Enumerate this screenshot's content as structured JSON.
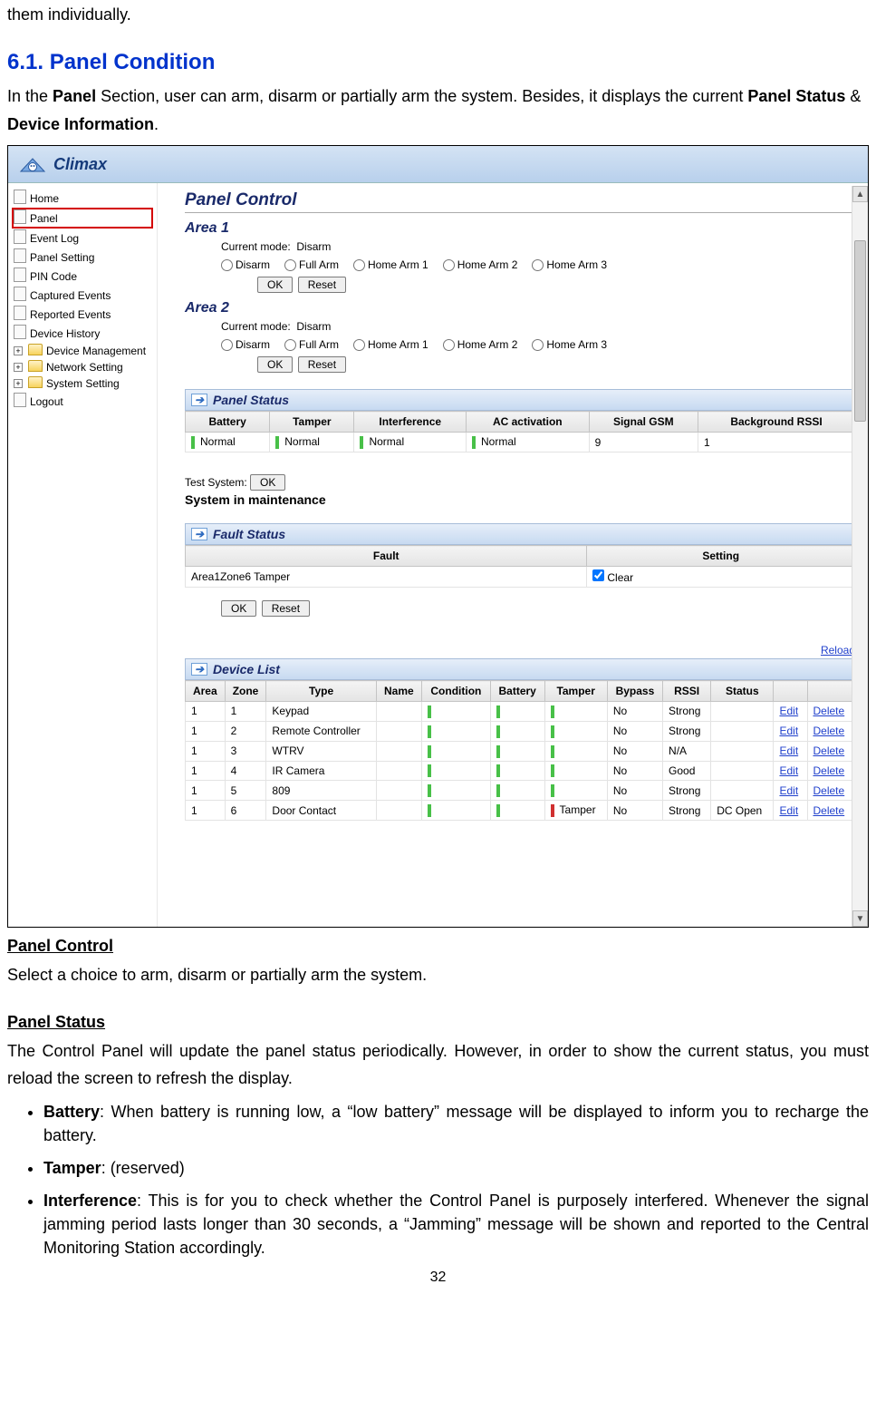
{
  "intro_frag": "them individually.",
  "section61": "6.1. Panel Condition",
  "p1a": "In the ",
  "p1b": "Panel",
  "p1c": " Section, user can arm, disarm or partially arm the system. Besides, it displays the current ",
  "p1d": "Panel Status",
  "p1e": " & ",
  "p1f": "Device Information",
  "p1g": ".",
  "brand": "Climax",
  "nav": [
    "Home",
    "Panel",
    "Event Log",
    "Panel Setting",
    "PIN Code",
    "Captured Events",
    "Reported Events",
    "Device History",
    "Device Management",
    "Network Setting",
    "System Setting",
    "Logout"
  ],
  "panelControlHeading": "Panel Control",
  "area1": "Area 1",
  "area2": "Area 2",
  "cm_label": "Current mode:",
  "cm_value": "Disarm",
  "radios": [
    "Disarm",
    "Full Arm",
    "Home Arm 1",
    "Home Arm 2",
    "Home Arm 3"
  ],
  "ok": "OK",
  "reset": "Reset",
  "psTitle": "Panel Status",
  "psHeaders": [
    "Battery",
    "Tamper",
    "Interference",
    "AC activation",
    "Signal GSM",
    "Background RSSI"
  ],
  "psRow": [
    "Normal",
    "Normal",
    "Normal",
    "Normal",
    "9",
    "1"
  ],
  "testLabel": "Test System:",
  "maint": "System in maintenance",
  "fsTitle": "Fault Status",
  "fsHeaders": [
    "Fault",
    "Setting"
  ],
  "fsFault": "Area1Zone6 Tamper",
  "fsClear": "Clear",
  "reload": "Reload",
  "dlTitle": "Device List",
  "dlHeaders": [
    "Area",
    "Zone",
    "Type",
    "Name",
    "Condition",
    "Battery",
    "Tamper",
    "Bypass",
    "RSSI",
    "Status",
    "",
    ""
  ],
  "devices": [
    {
      "area": "1",
      "zone": "1",
      "type": "Keypad",
      "name": "",
      "cond": "g",
      "batt": "g",
      "tamp": "g",
      "tampText": "",
      "bypass": "No",
      "rssi": "Strong",
      "status": ""
    },
    {
      "area": "1",
      "zone": "2",
      "type": "Remote Controller",
      "name": "",
      "cond": "g",
      "batt": "g",
      "tamp": "g",
      "tampText": "",
      "bypass": "No",
      "rssi": "Strong",
      "status": ""
    },
    {
      "area": "1",
      "zone": "3",
      "type": "WTRV",
      "name": "",
      "cond": "g",
      "batt": "g",
      "tamp": "g",
      "tampText": "",
      "bypass": "No",
      "rssi": "N/A",
      "status": ""
    },
    {
      "area": "1",
      "zone": "4",
      "type": "IR Camera",
      "name": "",
      "cond": "g",
      "batt": "g",
      "tamp": "g",
      "tampText": "",
      "bypass": "No",
      "rssi": "Good",
      "status": ""
    },
    {
      "area": "1",
      "zone": "5",
      "type": "809",
      "name": "",
      "cond": "g",
      "batt": "g",
      "tamp": "g",
      "tampText": "",
      "bypass": "No",
      "rssi": "Strong",
      "status": ""
    },
    {
      "area": "1",
      "zone": "6",
      "type": "Door Contact",
      "name": "",
      "cond": "g",
      "batt": "g",
      "tamp": "r",
      "tampText": "Tamper",
      "bypass": "No",
      "rssi": "Strong",
      "status": "DC Open"
    }
  ],
  "edit": "Edit",
  "delete": "Delete",
  "sub_pc": "Panel Control",
  "sub_pc_text": "Select a choice to arm, disarm or partially arm the system.",
  "sub_ps": "Panel Status",
  "sub_ps_text": "The Control Panel will update the panel status periodically. However, in order to show the current status, you must reload the screen to refresh the display.",
  "bullet_batt_h": "Battery",
  "bullet_batt_t": ": When battery is running low, a “low battery” message will be displayed to inform you to recharge the battery.",
  "bullet_tamp_h": "Tamper",
  "bullet_tamp_t": ": (reserved)",
  "bullet_int_h": "Interference",
  "bullet_int_t": ": This is for you to check whether the Control Panel is purposely interfered. Whenever the signal jamming period lasts longer than 30 seconds, a “Jamming” message will be shown and reported to the Central Monitoring Station accordingly.",
  "pagenum": "32"
}
